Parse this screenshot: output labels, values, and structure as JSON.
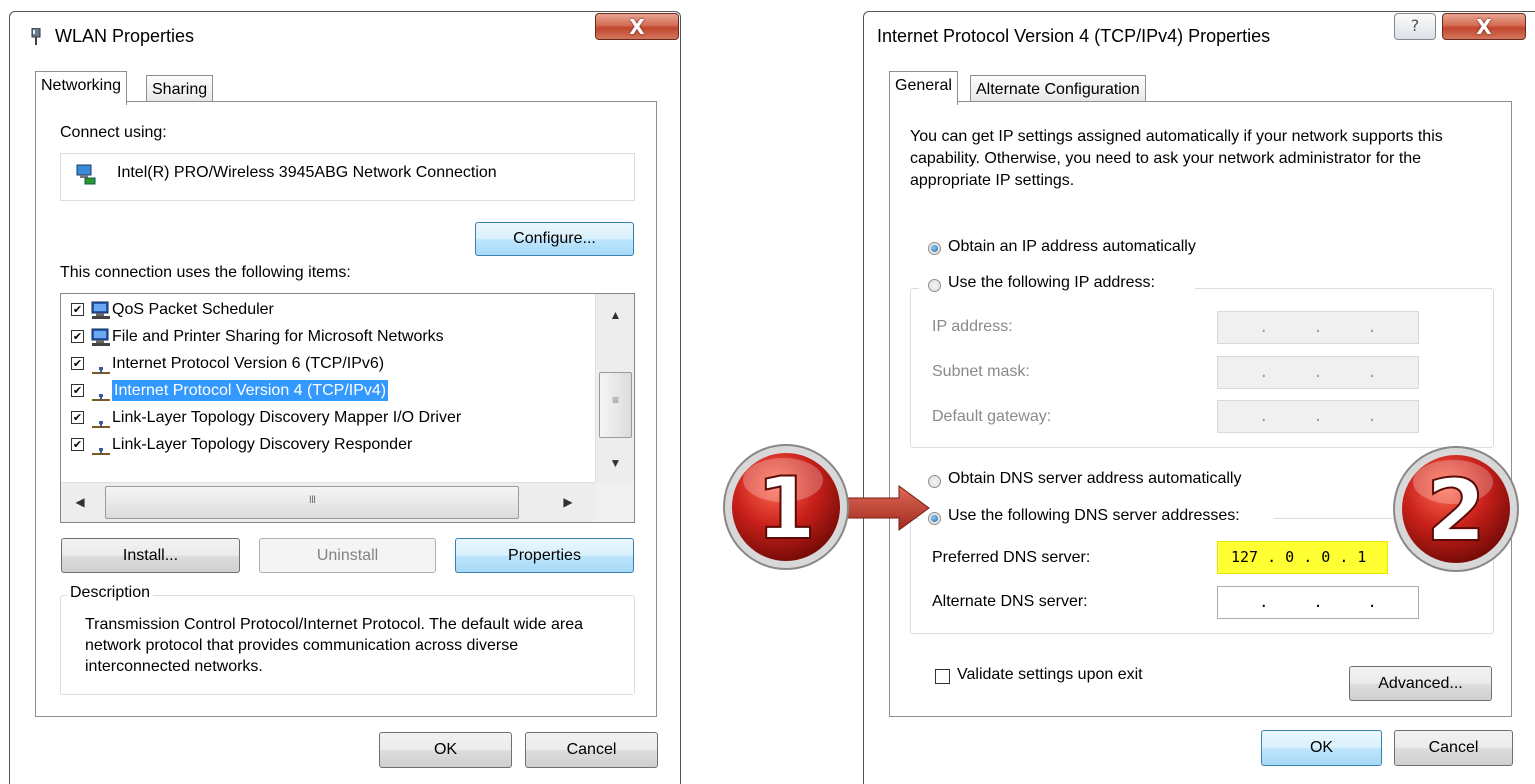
{
  "wlan": {
    "title": "WLAN Properties",
    "close_label": "X",
    "tabs": [
      "Networking",
      "Sharing"
    ],
    "connect_using_label": "Connect using:",
    "adapter_name": "Intel(R) PRO/Wireless 3945ABG Network Connection",
    "configure_label": "Configure...",
    "items_label": "This connection uses the following items:",
    "items": [
      {
        "label": "QoS Packet Scheduler",
        "checked": true,
        "icon": "client-icon",
        "selected": false
      },
      {
        "label": "File and Printer Sharing for Microsoft Networks",
        "checked": true,
        "icon": "client-icon",
        "selected": false
      },
      {
        "label": "Internet Protocol Version 6 (TCP/IPv6)",
        "checked": true,
        "icon": "protocol-icon",
        "selected": false
      },
      {
        "label": "Internet Protocol Version 4 (TCP/IPv4)",
        "checked": true,
        "icon": "protocol-icon",
        "selected": true
      },
      {
        "label": "Link-Layer Topology Discovery Mapper I/O Driver",
        "checked": true,
        "icon": "protocol-icon",
        "selected": false
      },
      {
        "label": "Link-Layer Topology Discovery Responder",
        "checked": true,
        "icon": "protocol-icon",
        "selected": false
      }
    ],
    "vscroll_thumb_glyph": "≡",
    "hscroll_thumb_glyph": "III",
    "install_label": "Install...",
    "uninstall_label": "Uninstall",
    "properties_label": "Properties",
    "description_legend": "Description",
    "description_text": "Transmission Control Protocol/Internet Protocol. The default wide area network protocol that provides communication across diverse interconnected networks.",
    "ok_label": "OK",
    "cancel_label": "Cancel"
  },
  "ipv4": {
    "title": "Internet Protocol Version 4 (TCP/IPv4) Properties",
    "help_label": "?",
    "close_label": "X",
    "tabs": [
      "General",
      "Alternate Configuration"
    ],
    "intro_text": "You can get IP settings assigned automatically if your network supports this capability. Otherwise, you need to ask your network administrator for the appropriate IP settings.",
    "obtain_ip_label": "Obtain an IP address automatically",
    "use_ip_label": "Use the following IP address:",
    "ip_address_label": "IP address:",
    "subnet_mask_label": "Subnet mask:",
    "default_gateway_label": "Default gateway:",
    "empty_ip_text": ".     .     .",
    "obtain_dns_label": "Obtain DNS server address automatically",
    "use_dns_label": "Use the following DNS server addresses:",
    "preferred_dns_label": "Preferred DNS server:",
    "preferred_dns_value": "127 . 0 . 0 . 1",
    "alternate_dns_label": "Alternate DNS server:",
    "alternate_dns_value": ".     .     .",
    "validate_label": "Validate settings upon exit",
    "advanced_label": "Advanced...",
    "ok_label": "OK",
    "cancel_label": "Cancel",
    "ip_mode": "obtain_automatically",
    "dns_mode": "use_following",
    "validate_checked": false
  },
  "annotations": {
    "badge_1": "1",
    "badge_2": "2",
    "badge_color": "#c8201a",
    "highlight_color": "#ffff33"
  }
}
